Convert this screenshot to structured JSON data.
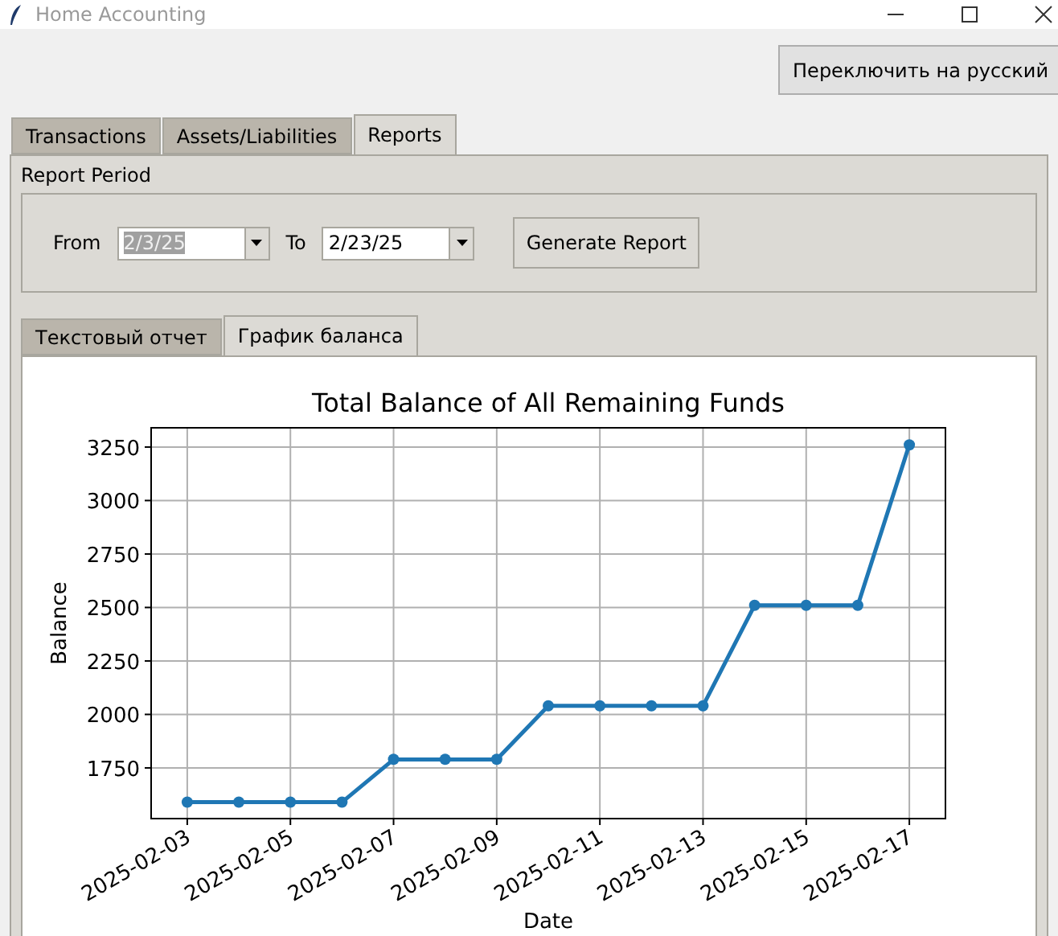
{
  "window": {
    "title": "Home Accounting"
  },
  "language_button": "Переключить на русский",
  "tabs": [
    {
      "label": "Transactions",
      "selected": false
    },
    {
      "label": "Assets/Liabilities",
      "selected": false
    },
    {
      "label": "Reports",
      "selected": true
    }
  ],
  "report_period": {
    "label": "Report Period",
    "from_label": "From",
    "from_value": "2/3/25",
    "from_text_selected": true,
    "to_label": "To",
    "to_value": "2/23/25",
    "to_text_selected": false,
    "generate_button": "Generate Report"
  },
  "report_tabs": [
    {
      "label": "Текстовый отчет",
      "selected": false
    },
    {
      "label": "График баланса",
      "selected": true
    }
  ],
  "chart_data": {
    "type": "line",
    "title": "Total Balance of All Remaining Funds",
    "xlabel": "Date",
    "ylabel": "Balance",
    "grid": true,
    "categories": [
      "2025-02-03",
      null,
      "2025-02-05",
      null,
      "2025-02-07",
      null,
      "2025-02-09",
      null,
      "2025-02-11",
      null,
      "2025-02-13",
      null,
      "2025-02-15",
      null,
      "2025-02-17"
    ],
    "series": [
      {
        "color": "#1f77b4",
        "marker": "o",
        "values": [
          1590,
          1590,
          1590,
          1590,
          1790,
          1790,
          1790,
          2040,
          2040,
          2040,
          2040,
          2510,
          2510,
          2510,
          3260
        ]
      }
    ],
    "ylim": [
      1513,
      3340
    ],
    "yticks": [
      1750,
      2000,
      2250,
      2500,
      2750,
      3000,
      3250
    ]
  }
}
